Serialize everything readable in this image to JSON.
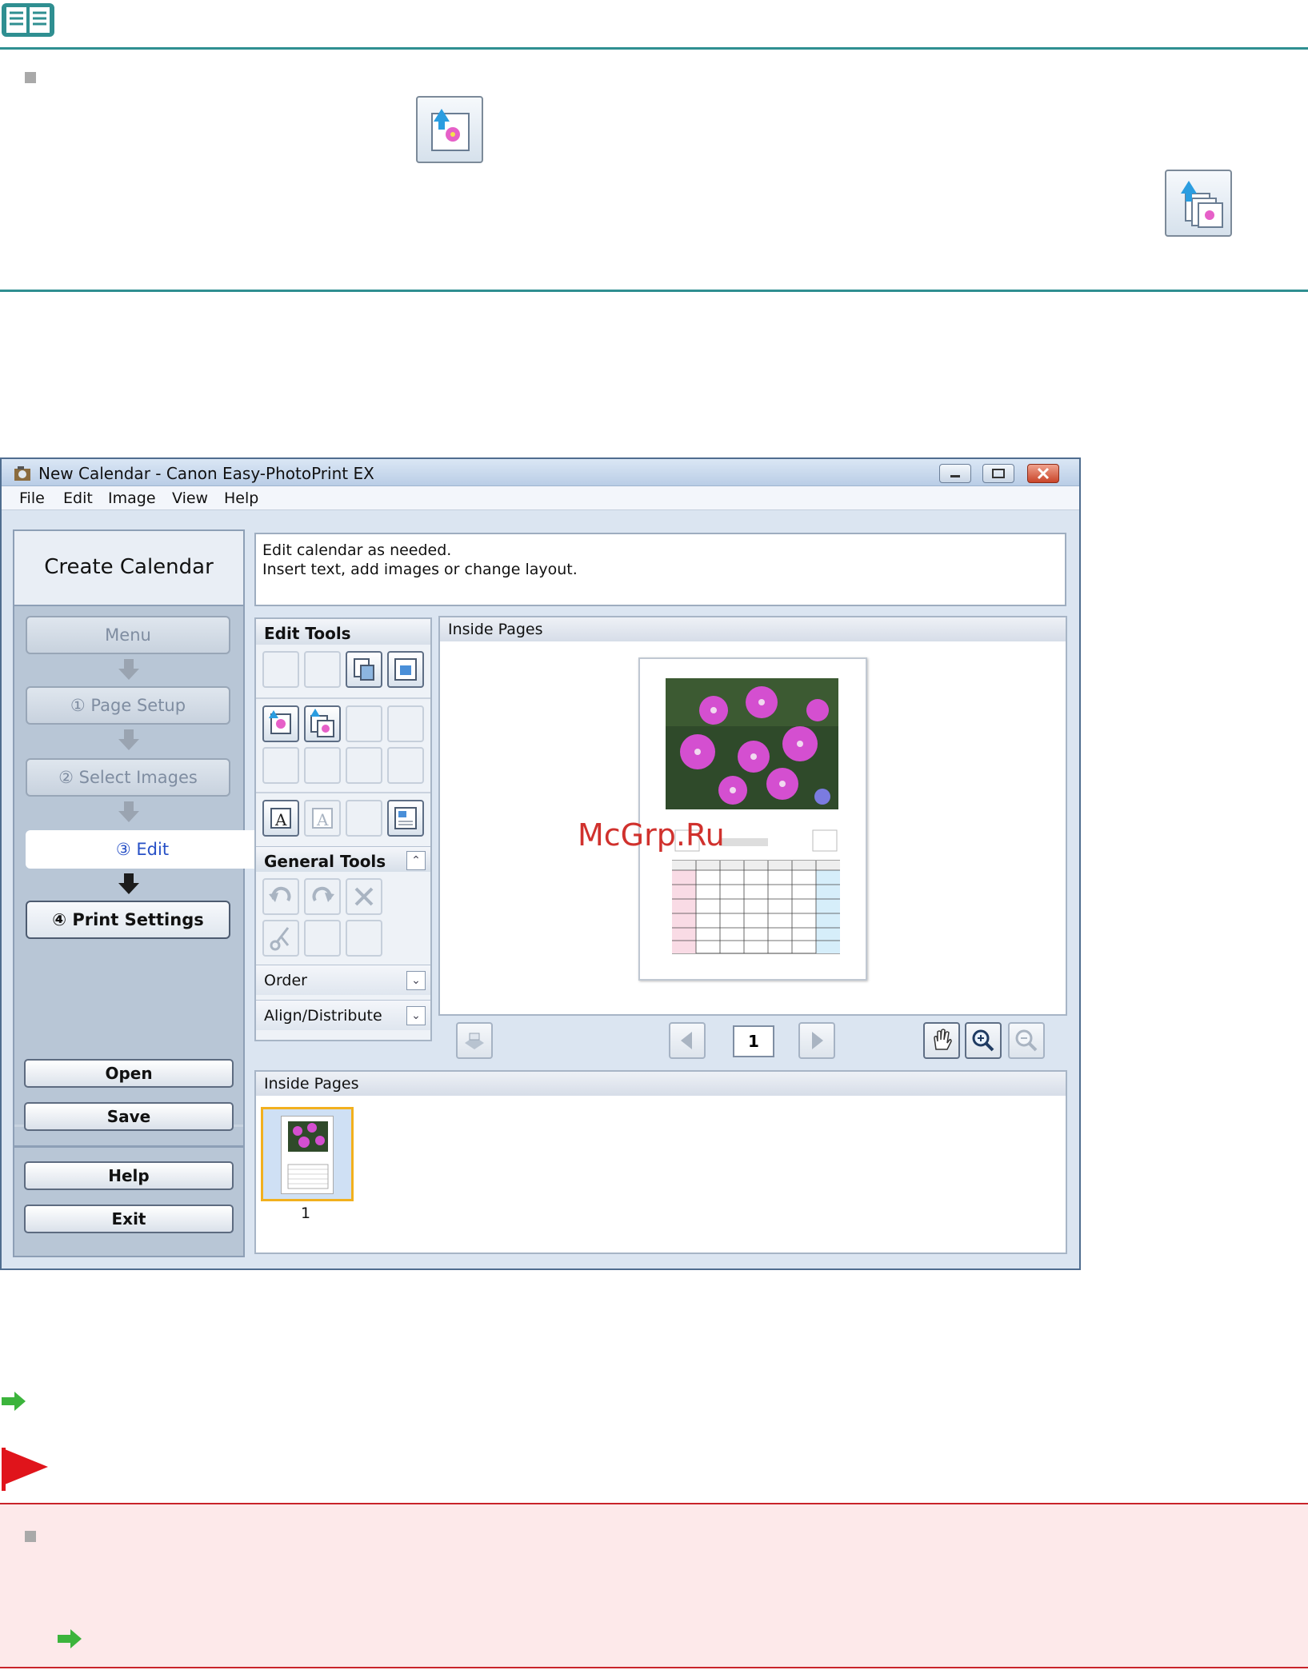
{
  "window": {
    "title": "New Calendar - Canon Easy-PhotoPrint EX",
    "menu": [
      "File",
      "Edit",
      "Image",
      "View",
      "Help"
    ]
  },
  "left_panel": {
    "title": "Create Calendar",
    "steps": {
      "menu": "Menu",
      "page_setup": "① Page Setup",
      "select_images": "② Select Images",
      "edit": "③ Edit",
      "print_settings": "④ Print Settings"
    },
    "buttons": {
      "open": "Open",
      "save": "Save",
      "help": "Help",
      "exit": "Exit"
    }
  },
  "message": {
    "line1": "Edit calendar as needed.",
    "line2": "Insert text, add images or change layout."
  },
  "tools": {
    "edit_tools": "Edit Tools",
    "general_tools": "General Tools",
    "order": "Order",
    "align_distribute": "Align/Distribute"
  },
  "preview": {
    "header": "Inside Pages",
    "page_number": "1"
  },
  "thumbnails": {
    "header": "Inside Pages",
    "items": [
      {
        "label": "1"
      }
    ]
  },
  "watermark": "McGrp.Ru",
  "colors": {
    "teal_rule": "#2f8f91",
    "red_rule": "#c9242a",
    "pink_bg": "#fde9ea",
    "green_arrow": "#3cb43c"
  }
}
